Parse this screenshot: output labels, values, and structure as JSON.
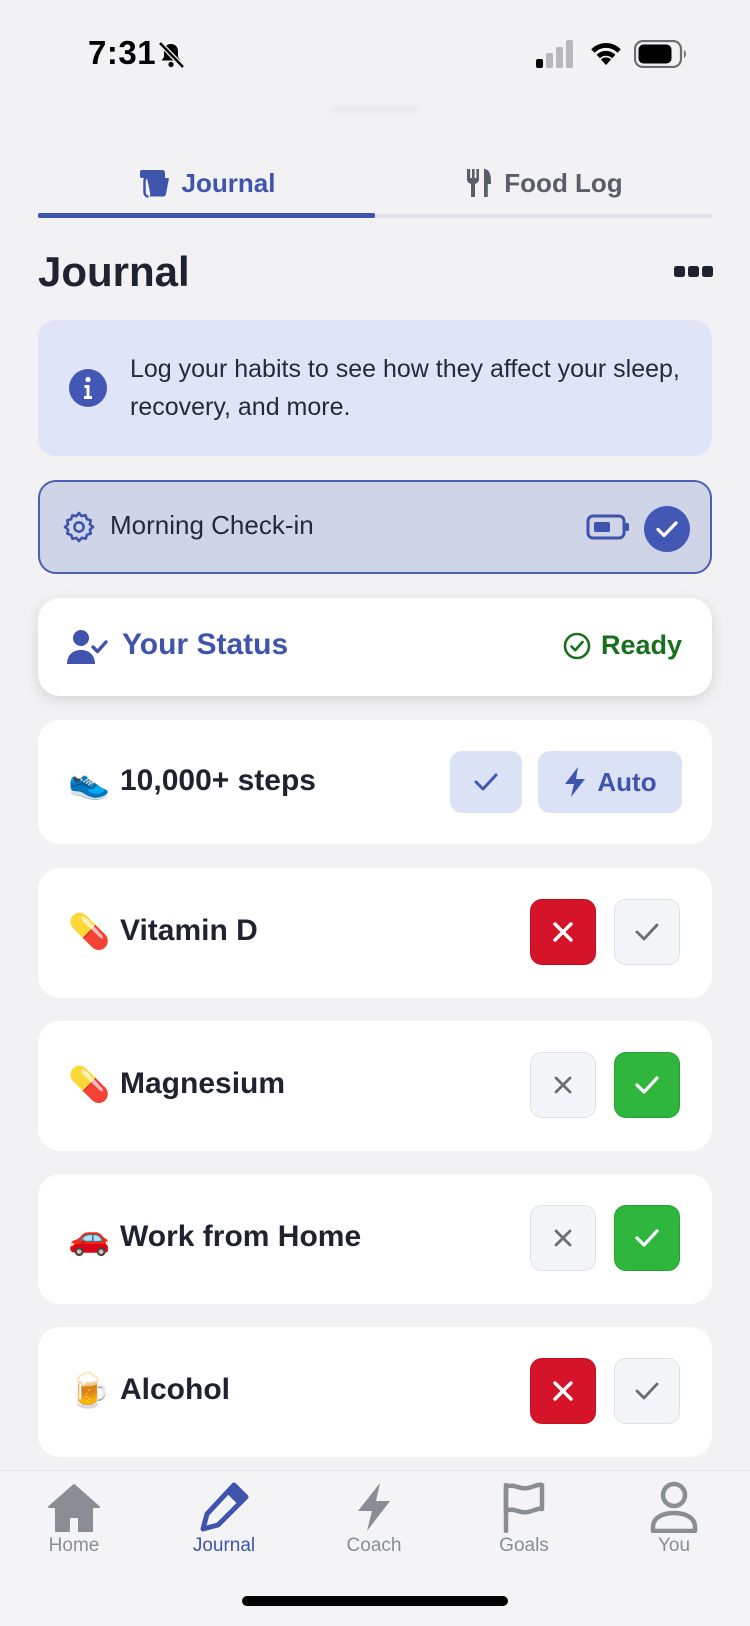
{
  "status_bar": {
    "time": "7:31",
    "icons": [
      "bell-slash-icon",
      "signal-icon",
      "wifi-icon",
      "battery-icon"
    ]
  },
  "tabs": [
    {
      "label": "Journal",
      "icon": "journal-icon",
      "active": true
    },
    {
      "label": "Food Log",
      "icon": "fork-knife-icon",
      "active": false
    }
  ],
  "page": {
    "title": "Journal",
    "more_icon": "ellipsis-icon"
  },
  "info_banner": {
    "icon": "info-icon",
    "text": "Log your habits to see how they affect your sleep, recovery, and more."
  },
  "checkin": {
    "label": "Morning Check-in",
    "icons": [
      "gear-icon",
      "battery-icon",
      "check-circle-icon"
    ]
  },
  "status_card": {
    "title": "Your Status",
    "state": "Ready",
    "icons": [
      "user-check-icon",
      "check-circle-outline-icon"
    ]
  },
  "habits": [
    {
      "emoji": "👟",
      "label": "10,000+ steps",
      "mode": "Auto",
      "answer": "yes"
    },
    {
      "emoji": "💊",
      "label": "Vitamin D",
      "answer": "no"
    },
    {
      "emoji": "💊",
      "label": "Magnesium",
      "answer": "yes"
    },
    {
      "emoji": "🚗",
      "label": "Work from Home",
      "answer": "yes"
    },
    {
      "emoji": "🍺",
      "label": "Alcohol",
      "answer": "no"
    }
  ],
  "bottom_nav": [
    {
      "label": "Home",
      "icon": "home-icon",
      "active": false
    },
    {
      "label": "Journal",
      "icon": "pencil-icon",
      "active": true
    },
    {
      "label": "Coach",
      "icon": "bolt-icon",
      "active": false
    },
    {
      "label": "Goals",
      "icon": "flag-icon",
      "active": false
    },
    {
      "label": "You",
      "icon": "person-icon",
      "active": false
    }
  ],
  "colors": {
    "accent": "#3e54ad",
    "no_active": "#d5142a",
    "yes_active": "#2fb73d",
    "ready": "#17701d",
    "banner_bg": "#dfe5f6"
  }
}
